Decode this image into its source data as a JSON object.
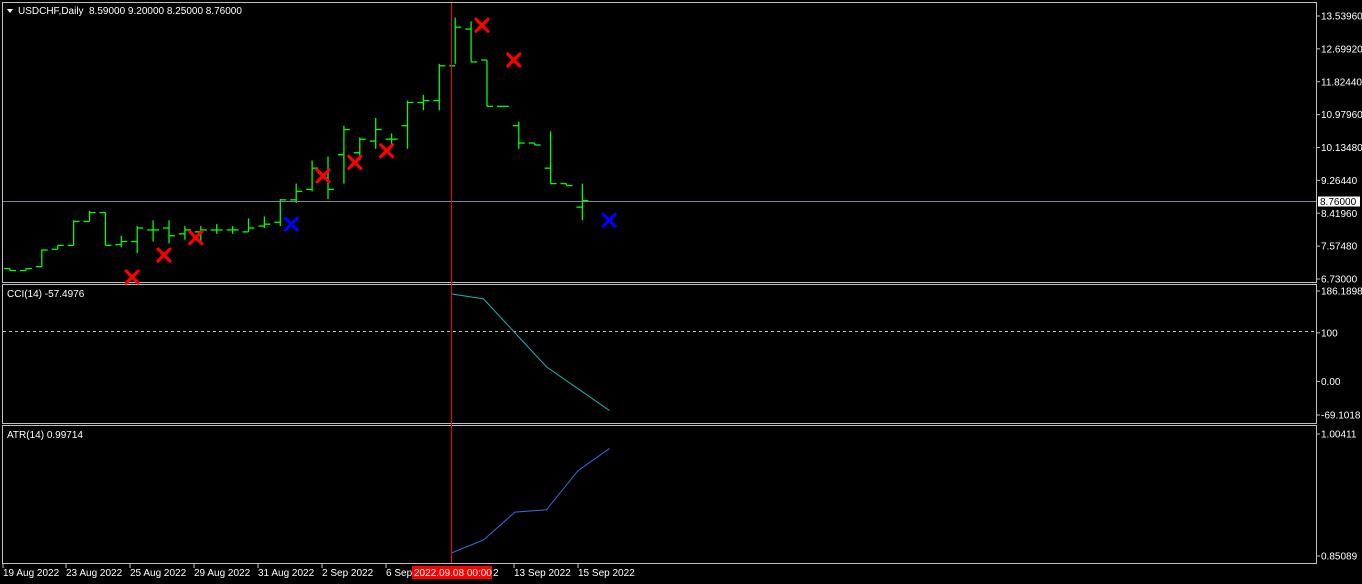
{
  "header": {
    "symbol": "USDCHF,Daily",
    "ohlc": "8.59000 9.20000 8.25000 8.76000",
    "menu_icon": "triangle-down-icon"
  },
  "main_axis": {
    "ticks": [
      "13.53960",
      "12.69920",
      "11.82440",
      "10.97960",
      "10.13480",
      "9.26440",
      "8.41960",
      "7.57480",
      "6.73000"
    ],
    "current_price": "8.76000"
  },
  "cci": {
    "title": "CCI(14) -57.4976",
    "ticks": [
      "186.1898",
      "100",
      "0.00",
      "-69.1018"
    ]
  },
  "atr": {
    "title": "ATR(14) 0.99714",
    "ticks": [
      "1.00411",
      "0.85089"
    ]
  },
  "time_axis": {
    "labels": [
      "19 Aug 2022",
      "23 Aug 2022",
      "25 Aug 2022",
      "29 Aug 2022",
      "31 Aug 2022",
      "2 Sep 2022",
      "6 Sep",
      "13 Sep 2022",
      "15 Sep 2022"
    ],
    "crosshair_time": "2022.09.08 00:00",
    "crosshair_suffix": "2"
  },
  "colors": {
    "background": "#000000",
    "bar": "#00ff00",
    "sell_marker": "#ff0000",
    "buy_marker": "#0000ff",
    "cci_line": "#20b2aa",
    "atr_line": "#4169e1",
    "crosshair": "#ff0000",
    "price_line": "#778899"
  },
  "chart_data": {
    "type": "ohlc",
    "ylim": [
      6.73,
      13.5396
    ],
    "bars": [
      {
        "o": 7.0,
        "h": 7.0,
        "l": 6.95,
        "c": 6.95
      },
      {
        "o": 6.95,
        "h": 7.0,
        "l": 6.95,
        "c": 7.0
      },
      {
        "o": 7.05,
        "h": 7.5,
        "l": 7.05,
        "c": 7.48
      },
      {
        "o": 7.5,
        "h": 7.6,
        "l": 7.5,
        "c": 7.6
      },
      {
        "o": 7.6,
        "h": 8.25,
        "l": 7.6,
        "c": 8.22
      },
      {
        "o": 8.22,
        "h": 8.5,
        "l": 8.22,
        "c": 8.45
      },
      {
        "o": 8.45,
        "h": 8.45,
        "l": 7.6,
        "c": 7.6
      },
      {
        "o": 7.62,
        "h": 7.85,
        "l": 7.55,
        "c": 7.7
      },
      {
        "o": 7.7,
        "h": 8.1,
        "l": 7.4,
        "c": 8.05
      },
      {
        "o": 8.0,
        "h": 8.25,
        "l": 7.7,
        "c": 8.0
      },
      {
        "o": 8.05,
        "h": 8.25,
        "l": 7.65,
        "c": 7.85
      },
      {
        "o": 7.9,
        "h": 8.1,
        "l": 7.75,
        "c": 8.0
      },
      {
        "o": 7.95,
        "h": 8.1,
        "l": 7.7,
        "c": 8.0
      },
      {
        "o": 8.0,
        "h": 8.15,
        "l": 7.9,
        "c": 8.0
      },
      {
        "o": 8.0,
        "h": 8.1,
        "l": 7.9,
        "c": 8.0
      },
      {
        "o": 7.95,
        "h": 8.3,
        "l": 7.95,
        "c": 8.05
      },
      {
        "o": 8.1,
        "h": 8.35,
        "l": 8.05,
        "c": 8.15
      },
      {
        "o": 8.2,
        "h": 8.8,
        "l": 8.1,
        "c": 8.78
      },
      {
        "o": 8.78,
        "h": 9.2,
        "l": 8.7,
        "c": 9.0
      },
      {
        "o": 9.05,
        "h": 9.8,
        "l": 9.0,
        "c": 9.6
      },
      {
        "o": 9.35,
        "h": 9.9,
        "l": 8.8,
        "c": 9.05
      },
      {
        "o": 9.95,
        "h": 10.7,
        "l": 9.2,
        "c": 10.6
      },
      {
        "o": 10.0,
        "h": 10.4,
        "l": 9.8,
        "c": 10.35
      },
      {
        "o": 10.3,
        "h": 10.9,
        "l": 10.1,
        "c": 10.6
      },
      {
        "o": 10.35,
        "h": 10.5,
        "l": 10.2,
        "c": 10.35
      },
      {
        "o": 10.7,
        "h": 11.35,
        "l": 10.1,
        "c": 11.3
      },
      {
        "o": 11.3,
        "h": 11.5,
        "l": 11.1,
        "c": 11.35
      },
      {
        "o": 11.35,
        "h": 12.3,
        "l": 11.1,
        "c": 12.25
      },
      {
        "o": 12.25,
        "h": 13.5,
        "l": 12.3,
        "c": 13.25
      },
      {
        "o": 13.2,
        "h": 13.4,
        "l": 12.35,
        "c": 12.35
      },
      {
        "o": 12.4,
        "h": 12.4,
        "l": 11.2,
        "c": 11.2
      },
      {
        "o": 11.2,
        "h": 11.2,
        "l": 11.2,
        "c": 11.2
      },
      {
        "o": 10.7,
        "h": 10.8,
        "l": 10.1,
        "c": 10.25
      },
      {
        "o": 10.25,
        "h": 10.25,
        "l": 10.2,
        "c": 10.2
      },
      {
        "o": 9.6,
        "h": 10.55,
        "l": 9.2,
        "c": 9.2
      },
      {
        "o": 9.2,
        "h": 9.2,
        "l": 9.15,
        "c": 9.15
      },
      {
        "o": 8.59,
        "h": 9.2,
        "l": 8.25,
        "c": 8.76
      }
    ],
    "markers": [
      {
        "bar": 4.0,
        "y": 6.78,
        "kind": "sell"
      },
      {
        "bar": 5.0,
        "y": 7.35,
        "kind": "sell"
      },
      {
        "bar": 6.0,
        "y": 7.8,
        "kind": "sell"
      },
      {
        "bar": 9.0,
        "y": 8.15,
        "kind": "buy"
      },
      {
        "bar": 10.0,
        "y": 9.4,
        "kind": "sell"
      },
      {
        "bar": 11.0,
        "y": 9.75,
        "kind": "sell"
      },
      {
        "bar": 12.0,
        "y": 10.05,
        "kind": "sell"
      },
      {
        "bar": 15.0,
        "y": 13.3,
        "kind": "sell"
      },
      {
        "bar": 16.0,
        "y": 12.4,
        "kind": "sell"
      },
      {
        "bar": 19.0,
        "y": 8.25,
        "kind": "buy"
      }
    ],
    "cci": {
      "ylim": [
        -69.1018,
        186.1898
      ],
      "values": [
        180,
        170,
        100,
        30,
        -15,
        -60
      ]
    },
    "atr": {
      "ylim": [
        0.85089,
        1.00411
      ],
      "values": [
        0.855,
        0.871,
        0.906,
        0.909,
        0.958,
        0.986
      ]
    },
    "crosshair_price": 8.76
  }
}
